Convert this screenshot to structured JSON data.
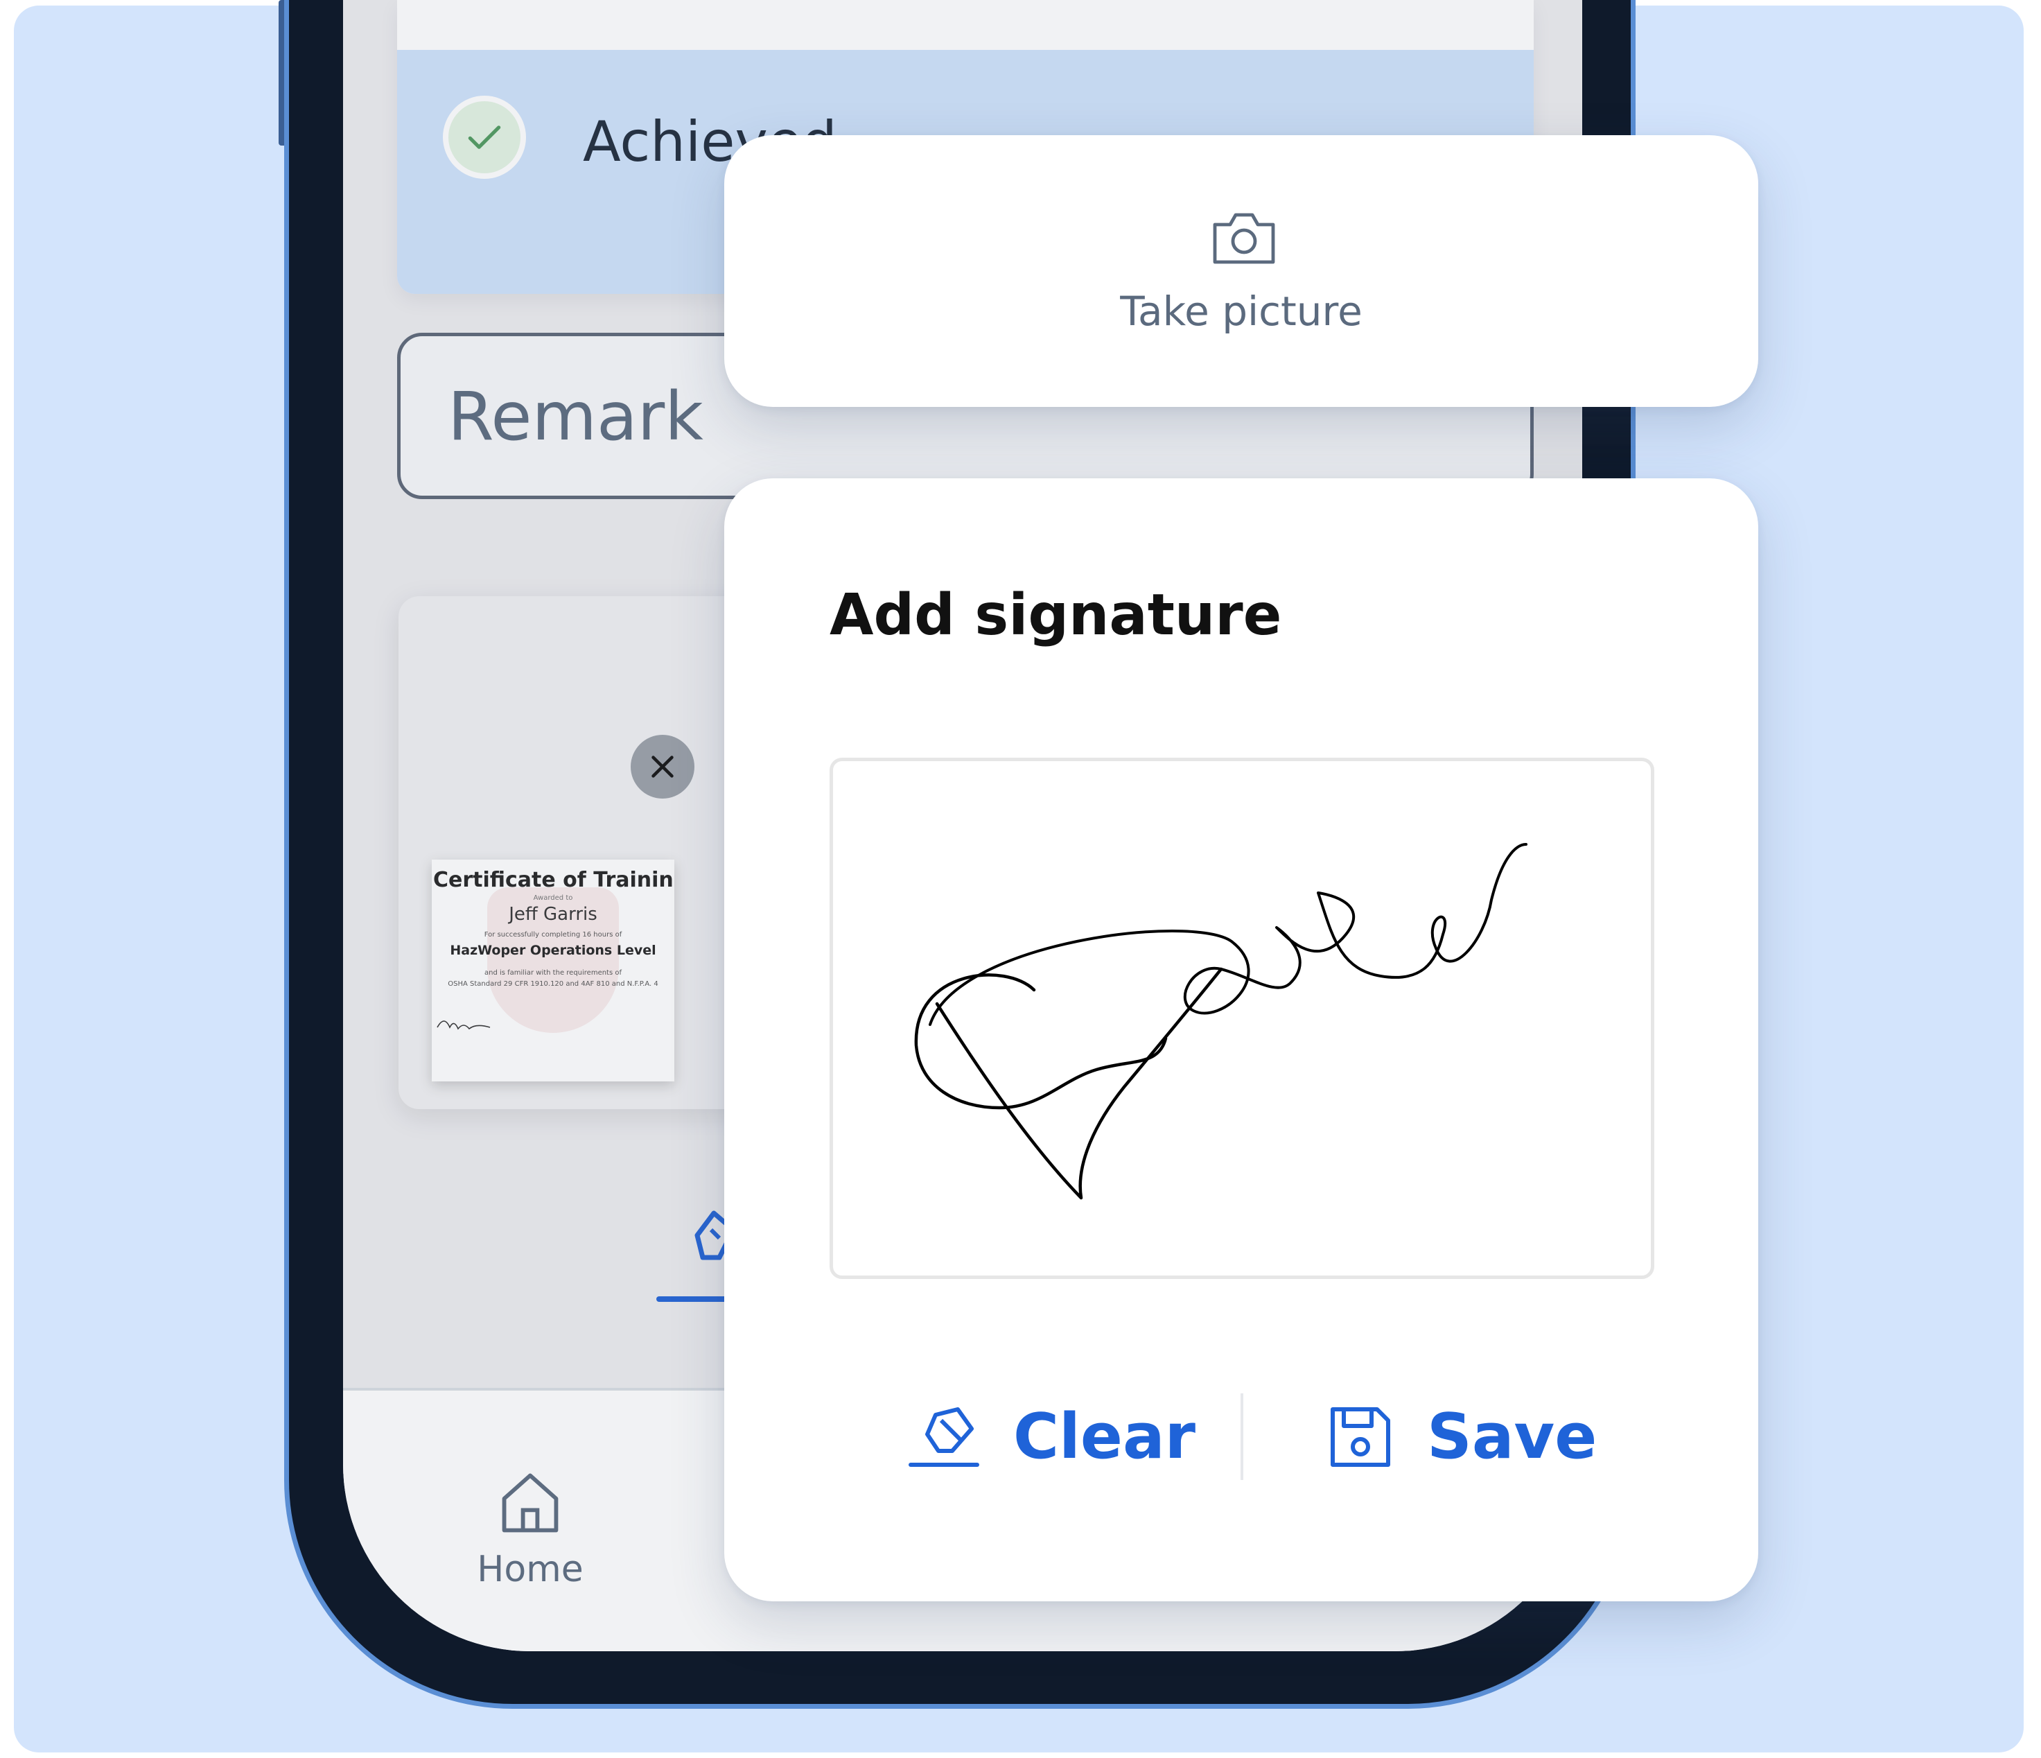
{
  "background": {
    "panel_color": "#d3e4fc"
  },
  "app": {
    "status_row": {
      "label": "Achieved",
      "icon": "check-icon"
    },
    "remark": {
      "placeholder": "Remark"
    },
    "attachment": {
      "certificate": {
        "title": "Certificate of Training",
        "awarded_to": "Awarded to",
        "name": "Jeff Garris",
        "line1": "For successfully completing 16 hours of",
        "course": "HazWoper Operations Level",
        "line2": "and is familiar with the requirements of",
        "line3": "OSHA Standard 29 CFR 1910.120 and 4AF 810 and N.F.P.A. 4"
      },
      "remove_icon": "close-icon"
    },
    "bottom_nav": {
      "home_label": "Home",
      "home_icon": "home-icon"
    }
  },
  "take_picture_card": {
    "label": "Take picture",
    "icon": "camera-icon"
  },
  "signature_card": {
    "title": "Add signature",
    "signature_text": "Pasha",
    "clear_label": "Clear",
    "clear_icon": "eraser-icon",
    "save_label": "Save",
    "save_icon": "floppy-disk-icon",
    "accent_color": "#1f63d8"
  }
}
